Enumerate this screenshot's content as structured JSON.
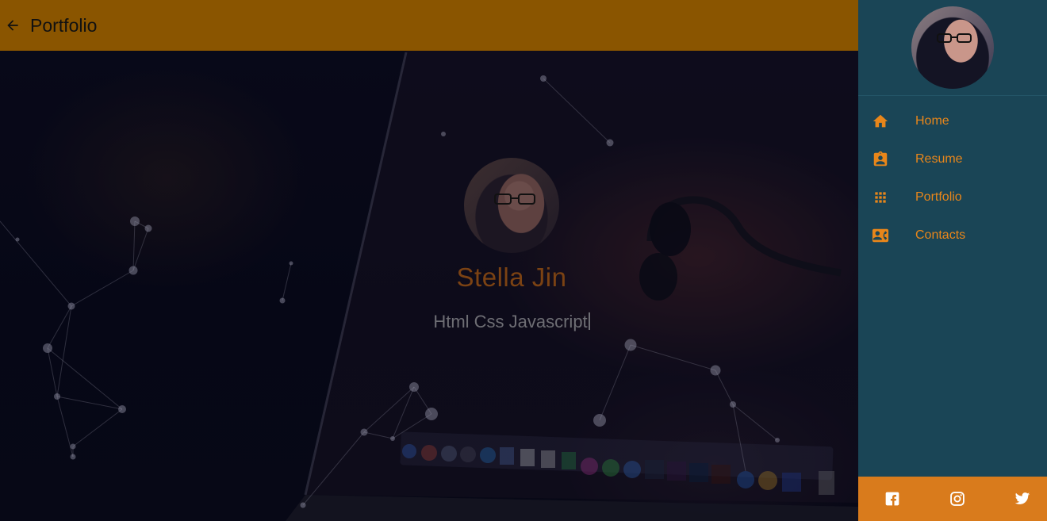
{
  "appbar": {
    "title": "Portfolio",
    "back_icon": "arrow-left-icon",
    "color": "#8a5500"
  },
  "hero": {
    "name": "Stella Jin",
    "skills": "Html Css Javascript",
    "name_color": "#7b4213"
  },
  "drawer": {
    "background": "#1a4556",
    "accent": "#e8861a",
    "items": [
      {
        "label": "Home",
        "icon": "home-icon"
      },
      {
        "label": "Resume",
        "icon": "resume-badge-icon"
      },
      {
        "label": "Portfolio",
        "icon": "grid-apps-icon"
      },
      {
        "label": "Contacts",
        "icon": "contact-card-icon"
      }
    ],
    "social": [
      {
        "icon": "facebook-icon"
      },
      {
        "icon": "instagram-icon"
      },
      {
        "icon": "twitter-icon"
      }
    ],
    "footer_color": "#d97b1c"
  }
}
